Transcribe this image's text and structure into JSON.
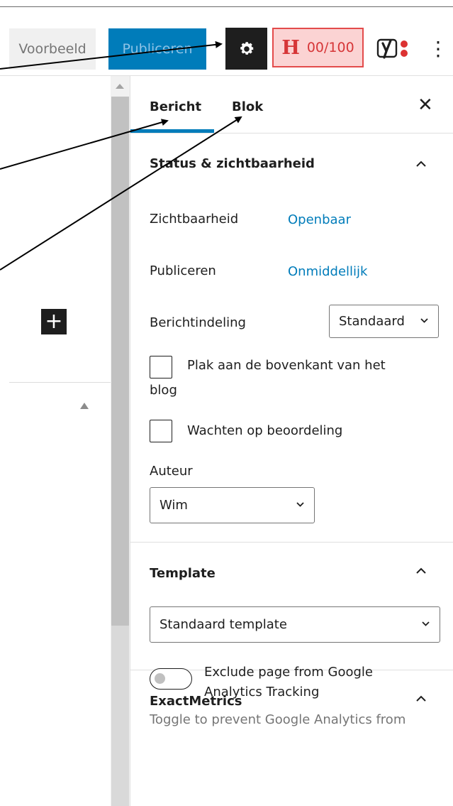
{
  "toolbar": {
    "preview_label": "Voorbeeld",
    "publish_label": "Publiceren",
    "headline_letter": "H",
    "headline_score": "00/100",
    "more_label": "⋮"
  },
  "sidebar": {
    "tabs": [
      {
        "label": "Bericht",
        "active": true
      },
      {
        "label": "Blok",
        "active": false
      }
    ],
    "close_label": "✕",
    "status_panel": {
      "title": "Status & zichtbaarheid",
      "visibility_label": "Zichtbaarheid",
      "visibility_value": "Openbaar",
      "publish_label": "Publiceren",
      "publish_value": "Onmiddellijk",
      "format_label": "Berichtindeling",
      "format_value": "Standaard",
      "sticky_line1": "Plak aan de bovenkant van het",
      "sticky_line2": "blog",
      "pending_label": "Wachten op beoordeling",
      "author_label": "Auteur",
      "author_value": "Wim"
    },
    "template_panel": {
      "title": "Template",
      "template_value": "Standaard template"
    },
    "exactmetrics_panel": {
      "title": "ExactMetrics",
      "toggle_label": "Exclude page from Google Analytics Tracking",
      "help_text": "Toggle to prevent Google Analytics from"
    }
  },
  "editor": {
    "add_block_label": "+"
  },
  "colors": {
    "accent": "#007cba",
    "headline_border": "#e34b4b",
    "headline_bg": "#fbd3d3",
    "yoast_dot": "#dc3232"
  }
}
